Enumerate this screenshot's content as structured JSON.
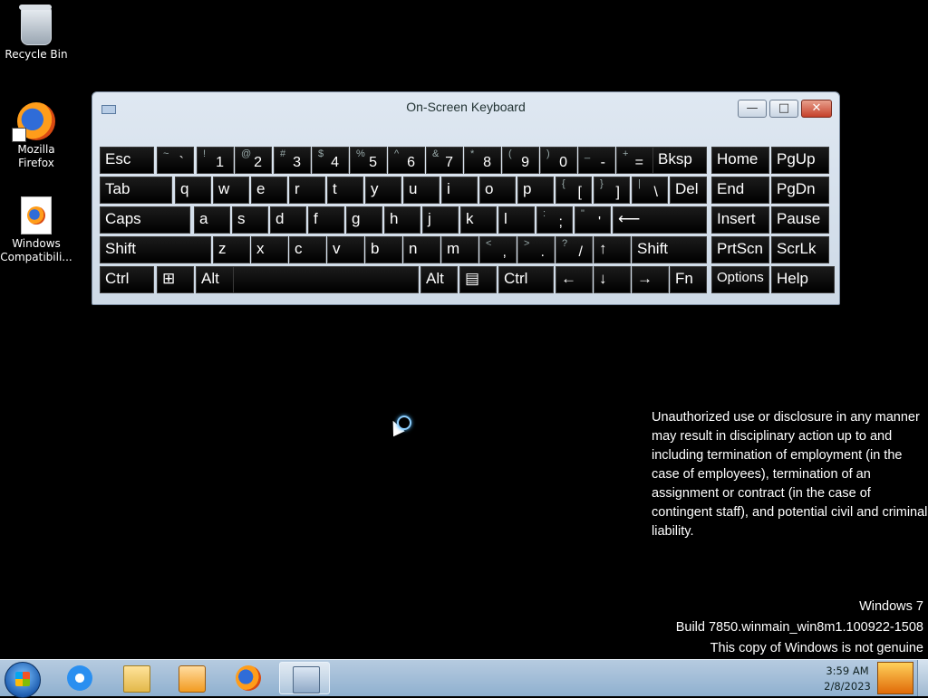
{
  "desktop": {
    "icons": [
      {
        "label": "Recycle Bin"
      },
      {
        "label": "Mozilla\nFirefox"
      },
      {
        "label": "Windows\nCompatibili..."
      }
    ]
  },
  "osk": {
    "title": "On-Screen Keyboard",
    "buttons": {
      "minimize": "—",
      "maximize": "□",
      "close": "✕"
    },
    "rows": {
      "r1": [
        {
          "label": "Esc"
        },
        {
          "sh": "~",
          "mn": "`"
        },
        {
          "sh": "!",
          "mn": "1"
        },
        {
          "sh": "@",
          "mn": "2"
        },
        {
          "sh": "#",
          "mn": "3"
        },
        {
          "sh": "$",
          "mn": "4"
        },
        {
          "sh": "%",
          "mn": "5"
        },
        {
          "sh": "^",
          "mn": "6"
        },
        {
          "sh": "&",
          "mn": "7"
        },
        {
          "sh": "*",
          "mn": "8"
        },
        {
          "sh": "(",
          "mn": "9"
        },
        {
          "sh": ")",
          "mn": "0"
        },
        {
          "sh": "_",
          "mn": "-"
        },
        {
          "sh": "+",
          "mn": "="
        },
        {
          "label": "Bksp"
        }
      ],
      "r2": [
        {
          "label": "Tab"
        },
        {
          "label": "q"
        },
        {
          "label": "w"
        },
        {
          "label": "e"
        },
        {
          "label": "r"
        },
        {
          "label": "t"
        },
        {
          "label": "y"
        },
        {
          "label": "u"
        },
        {
          "label": "i"
        },
        {
          "label": "o"
        },
        {
          "label": "p"
        },
        {
          "sh": "{",
          "mn": "["
        },
        {
          "sh": "}",
          "mn": "]"
        },
        {
          "sh": "|",
          "mn": "\\"
        },
        {
          "label": "Del"
        }
      ],
      "r3": [
        {
          "label": "Caps"
        },
        {
          "label": "a"
        },
        {
          "label": "s"
        },
        {
          "label": "d"
        },
        {
          "label": "f"
        },
        {
          "label": "g"
        },
        {
          "label": "h"
        },
        {
          "label": "j"
        },
        {
          "label": "k"
        },
        {
          "label": "l"
        },
        {
          "sh": ":",
          "mn": ";"
        },
        {
          "sh": "\"",
          "mn": "'"
        },
        {
          "label": "⟵"
        }
      ],
      "r4": [
        {
          "label": "Shift"
        },
        {
          "label": "z"
        },
        {
          "label": "x"
        },
        {
          "label": "c"
        },
        {
          "label": "v"
        },
        {
          "label": "b"
        },
        {
          "label": "n"
        },
        {
          "label": "m"
        },
        {
          "sh": "<",
          "mn": ","
        },
        {
          "sh": ">",
          "mn": "."
        },
        {
          "sh": "?",
          "mn": "/"
        },
        {
          "label": "↑"
        },
        {
          "label": "Shift"
        }
      ],
      "r5": [
        {
          "label": "Ctrl"
        },
        {
          "label": "⊞"
        },
        {
          "label": "Alt"
        },
        {
          "label": ""
        },
        {
          "label": "Alt"
        },
        {
          "label": "▤"
        },
        {
          "label": "Ctrl"
        },
        {
          "label": "←"
        },
        {
          "label": "↓"
        },
        {
          "label": "→"
        },
        {
          "label": "Fn"
        }
      ]
    },
    "nav": [
      [
        "Home",
        "PgUp"
      ],
      [
        "End",
        "PgDn"
      ],
      [
        "Insert",
        "Pause"
      ],
      [
        "PrtScn",
        "ScrLk"
      ],
      [
        "Options",
        "Help"
      ]
    ]
  },
  "notice": "Unauthorized use or disclosure in any manner may result in disciplinary action up to and including termination of employment (in the case of employees), termination of an assignment or contract (in the case of contingent staff), and potential civil and criminal liability.",
  "watermark": {
    "line1": "Windows 7",
    "line2": "Build 7850.winmain_win8m1.100922-1508",
    "line3": "This copy of Windows is not genuine"
  },
  "taskbar": {
    "time": "3:59 AM",
    "date": "2/8/2023",
    "items": [
      "internet-explorer",
      "windows-explorer",
      "media-player",
      "firefox",
      "on-screen-keyboard"
    ]
  }
}
